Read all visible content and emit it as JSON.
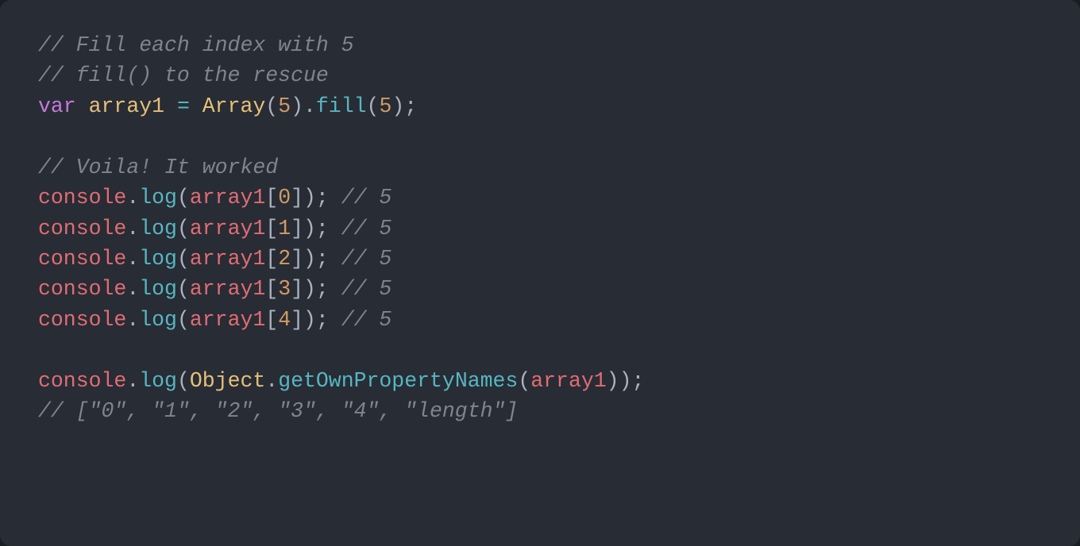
{
  "code": {
    "line1_comment": "// Fill each index with 5",
    "line2_comment": "// fill() to the rescue",
    "line3": {
      "kw_var": "var",
      "sp1": " ",
      "ident": "array1",
      "sp2": " ",
      "eq": "=",
      "sp3": " ",
      "klass": "Array",
      "lp1": "(",
      "num1": "5",
      "rp1": ")",
      "dot1": ".",
      "fill": "fill",
      "lp2": "(",
      "num2": "5",
      "rp2_semi": ");"
    },
    "blank1": "",
    "line5_comment": "// Voila! It worked",
    "log_lines": [
      {
        "console": "console",
        "dot": ".",
        "log": "log",
        "lp": "(",
        "arr": "array1",
        "lb": "[",
        "idx": "0",
        "rb": "]",
        "close": ");",
        "sp": " ",
        "cmt": "// 5"
      },
      {
        "console": "console",
        "dot": ".",
        "log": "log",
        "lp": "(",
        "arr": "array1",
        "lb": "[",
        "idx": "1",
        "rb": "]",
        "close": ");",
        "sp": " ",
        "cmt": "// 5"
      },
      {
        "console": "console",
        "dot": ".",
        "log": "log",
        "lp": "(",
        "arr": "array1",
        "lb": "[",
        "idx": "2",
        "rb": "]",
        "close": ");",
        "sp": " ",
        "cmt": "// 5"
      },
      {
        "console": "console",
        "dot": ".",
        "log": "log",
        "lp": "(",
        "arr": "array1",
        "lb": "[",
        "idx": "3",
        "rb": "]",
        "close": ");",
        "sp": " ",
        "cmt": "// 5"
      },
      {
        "console": "console",
        "dot": ".",
        "log": "log",
        "lp": "(",
        "arr": "array1",
        "lb": "[",
        "idx": "4",
        "rb": "]",
        "close": ");",
        "sp": " ",
        "cmt": "// 5"
      }
    ],
    "blank2": "",
    "line12": {
      "console": "console",
      "dot1": ".",
      "log": "log",
      "lp": "(",
      "obj": "Object",
      "dot2": ".",
      "method": "getOwnPropertyNames",
      "lp2": "(",
      "arr": "array1",
      "close": "));"
    },
    "line13_comment": "// [\"0\", \"1\", \"2\", \"3\", \"4\", \"length\"]"
  }
}
